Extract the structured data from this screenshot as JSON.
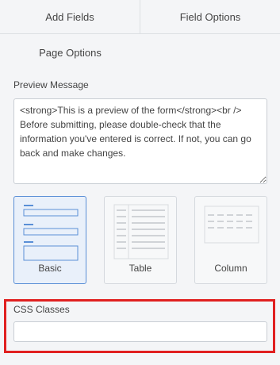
{
  "tabs": {
    "add_fields": "Add Fields",
    "field_options": "Field Options",
    "page_options": "Page Options"
  },
  "preview": {
    "label": "Preview Message",
    "value": "<strong>This is a preview of the form</strong><br />\nBefore submitting, please double-check that the information you've entered is correct. If not, you can go back and make changes."
  },
  "layouts": [
    {
      "label": "Basic",
      "selected": true
    },
    {
      "label": "Table",
      "selected": false
    },
    {
      "label": "Column",
      "selected": false
    }
  ],
  "css_classes": {
    "label": "CSS Classes",
    "value": ""
  },
  "colors": {
    "accent": "#5a8fd6",
    "highlight": "#e02020"
  }
}
